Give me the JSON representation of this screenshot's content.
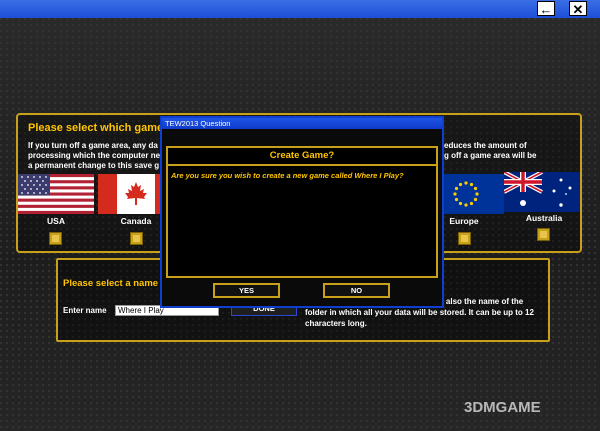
{
  "window": {
    "back_icon": "←",
    "close_icon": "✕"
  },
  "game_area": {
    "title": "Please select which game are",
    "desc_left_1": "If you turn off a game area, any da",
    "desc_left_2": "processing which the computer ne",
    "desc_left_3": "a permanent change to this save g",
    "desc_right_1": "educes the amount of",
    "desc_right_2": "g off a game area will be",
    "flags": [
      {
        "key": "usa",
        "label": "USA"
      },
      {
        "key": "canada",
        "label": "Canada"
      },
      {
        "key": "europe",
        "label": "Europe"
      },
      {
        "key": "australia",
        "label": "Australia"
      }
    ]
  },
  "name_panel": {
    "title": "Please select a name",
    "enter_label": "Enter name",
    "input_value": "Where I Play",
    "done_label": "DONE",
    "desc": "game is identified for loading, and is also the name of the folder in which all your data will be stored. It can be up to 12 characters long."
  },
  "dialog": {
    "window_title": "TEW2013 Question",
    "heading": "Create Game?",
    "message": "Are you sure you wish to create a new game called Where I Play?",
    "yes_label": "YES",
    "no_label": "NO"
  },
  "watermark": "3DMGAME",
  "colors": {
    "accent": "#ffc400",
    "border": "#c9a019",
    "titlebar": "#1d4fd8"
  }
}
